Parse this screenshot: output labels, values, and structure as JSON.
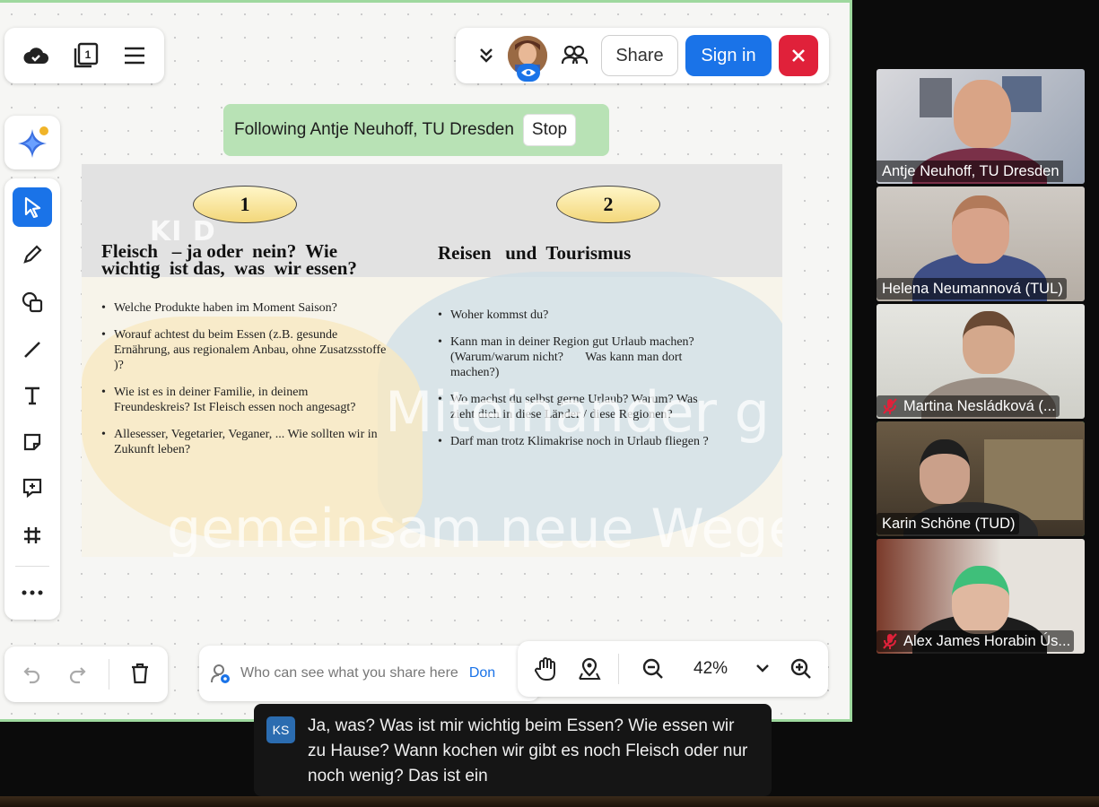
{
  "toolbar_top_right": {
    "share_label": "Share",
    "signin_label": "Sign in"
  },
  "following": {
    "text": "Following Antje Neuhoff, TU Dresden",
    "stop_label": "Stop"
  },
  "slide": {
    "left": {
      "number": "1",
      "title_line1": "Fleisch   – ja oder  nein?  Wie",
      "title_line2": "wichtig  ist das,  was  wir essen?",
      "bullets": [
        "Welche Produkte haben im Moment Saison?",
        "Worauf achtest du beim Essen (z.B. gesunde Ernährung, aus regionalem Anbau, ohne Zusatzsstoffe   )?",
        "Wie ist es in deiner Familie, in deinem Freundeskreis? Ist Fleisch essen noch angesagt?",
        "Allesesser, Vegetarier, Veganer, ... Wie sollten wir in Zukunft leben?"
      ]
    },
    "right": {
      "number": "2",
      "title": "Reisen   und  Tourismus",
      "bullets": [
        "Woher kommst du?",
        "Kann man in deiner Region gut Urlaub machen?  (Warum/warum nicht?       Was kann man dort machen?)",
        "Wo machst du selbst gerne Urlaub? Warum? Was zieht dich in diese Länder / diese Regionen?",
        "Darf man trotz Klimakrise noch in Urlaub fliegen ?"
      ]
    },
    "watermark_logo": "KI D",
    "watermark_line1": "Miteinander g",
    "watermark_line2": "gemeinsam neue Wege"
  },
  "share_info": {
    "text": "Who can see what you share here",
    "done_label": "Don"
  },
  "zoom": {
    "level": "42%"
  },
  "participants": [
    {
      "name": "Antje Neuhoff, TU Dresden",
      "muted": false,
      "speaking": false
    },
    {
      "name": "Helena Neumannová (TUL)",
      "muted": false,
      "speaking": false
    },
    {
      "name": "Martina Nesládková (...",
      "muted": true,
      "speaking": false
    },
    {
      "name": "Karin Schöne (TUD)",
      "muted": false,
      "speaking": true
    },
    {
      "name": "Alex James Horabin Ús...",
      "muted": true,
      "speaking": false
    }
  ],
  "caption": {
    "initials": "KS",
    "text": "Ja, was? Was ist mir wichtig beim Essen? Wie essen wir zu Hause? Wann kochen wir gibt es noch Fleisch oder nur noch wenig? Das ist ein"
  },
  "colors": {
    "accent": "#1a73e8",
    "close": "#e0213a",
    "following_bg": "#b8e2b5",
    "board_border": "#9ed89e",
    "speaking_outline": "#22d36a"
  }
}
